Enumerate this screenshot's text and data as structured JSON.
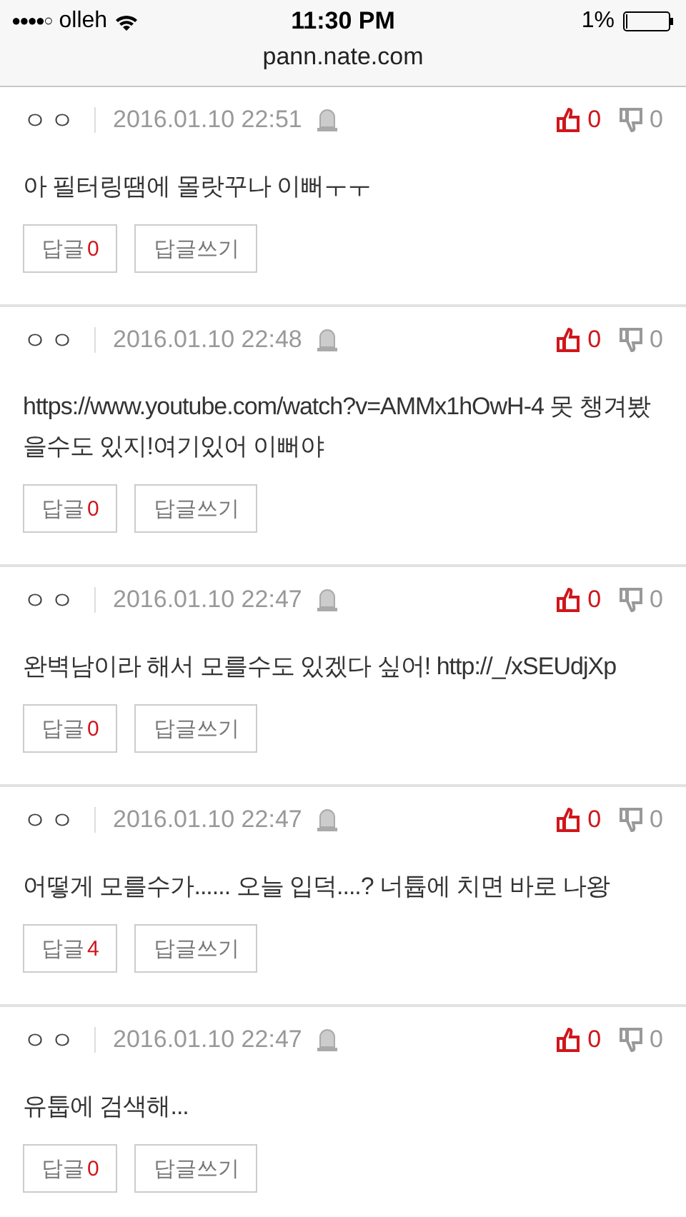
{
  "status_bar": {
    "signal": "●●●●○",
    "carrier": "olleh",
    "time": "11:30 PM",
    "battery": "1%"
  },
  "address_bar": {
    "url": "pann.nate.com"
  },
  "comments": [
    {
      "author": "ㅇㅇ",
      "date": "2016.01.10 22:51",
      "likes": "0",
      "dislikes": "0",
      "text": "아 필터링땜에 몰랏꾸나 이뻐ㅜㅜ",
      "reply_label": "답글",
      "reply_count": "0",
      "write_label": "답글쓰기"
    },
    {
      "author": "ㅇㅇ",
      "date": "2016.01.10 22:48",
      "likes": "0",
      "dislikes": "0",
      "text": "https://www.youtube.com/watch?v=AMMx1hOwH-4 못 챙겨봤을수도 있지!여기있어 이뻐야",
      "reply_label": "답글",
      "reply_count": "0",
      "write_label": "답글쓰기"
    },
    {
      "author": "ㅇㅇ",
      "date": "2016.01.10 22:47",
      "likes": "0",
      "dislikes": "0",
      "text": "완벽남이라 해서 모를수도 있겠다 싶어! http://_/xSEUdjXp",
      "reply_label": "답글",
      "reply_count": "0",
      "write_label": "답글쓰기"
    },
    {
      "author": "ㅇㅇ",
      "date": "2016.01.10 22:47",
      "likes": "0",
      "dislikes": "0",
      "text": "어떻게 모를수가...... 오늘 입덕....? 너튭에 치면 바로 나왕",
      "reply_label": "답글",
      "reply_count": "4",
      "write_label": "답글쓰기"
    },
    {
      "author": "ㅇㅇ",
      "date": "2016.01.10 22:47",
      "likes": "0",
      "dislikes": "0",
      "text": "유툽에 검색해...",
      "reply_label": "답글",
      "reply_count": "0",
      "write_label": "답글쓰기"
    }
  ]
}
